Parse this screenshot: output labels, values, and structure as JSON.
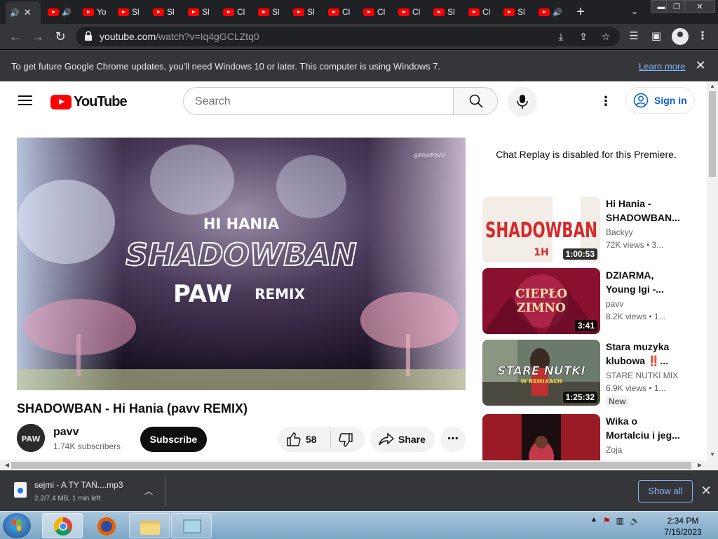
{
  "tabs": [
    {
      "label": "",
      "icon": "speaker-icon",
      "active": true
    },
    {
      "label": "",
      "icon": "youtube-favicon",
      "speaker": true
    },
    {
      "label": "Yo",
      "icon": "youtube-favicon"
    },
    {
      "label": "Sl",
      "icon": "youtube-favicon"
    },
    {
      "label": "Sl",
      "icon": "youtube-favicon"
    },
    {
      "label": "Sl",
      "icon": "youtube-favicon"
    },
    {
      "label": "Cl",
      "icon": "youtube-favicon"
    },
    {
      "label": "Sl",
      "icon": "youtube-favicon"
    },
    {
      "label": "Sl",
      "icon": "youtube-favicon"
    },
    {
      "label": "Cl",
      "icon": "youtube-favicon"
    },
    {
      "label": "Cl",
      "icon": "youtube-favicon"
    },
    {
      "label": "Cl",
      "icon": "youtube-favicon"
    },
    {
      "label": "Sl",
      "icon": "youtube-favicon"
    },
    {
      "label": "Cl",
      "icon": "youtube-favicon"
    },
    {
      "label": "Sl",
      "icon": "youtube-favicon"
    },
    {
      "label": "",
      "icon": "youtube-favicon",
      "speaker": true
    }
  ],
  "toolbar": {
    "url_host": "youtube.com",
    "url_path": "/watch?v=Iq4gGCLZtq0"
  },
  "infobar": {
    "message": "To get future Google Chrome updates, you'll need Windows 10 or later. This computer is using Windows 7.",
    "link": "Learn more"
  },
  "youtube": {
    "logo_text": "YouTube",
    "search_placeholder": "Search",
    "signin_label": "Sign in",
    "video": {
      "title": "SHADOWBAN - Hi Hania (pavv REMIX)",
      "overlay_artist": "HI HANIA",
      "overlay_title": "SHADOWBAN",
      "overlay_brand": "PAW",
      "overlay_remix": "REMIX",
      "overlay_handle": "@PAWPAVV"
    },
    "channel": {
      "name": "pavv",
      "subscribers": "1.74K subscribers",
      "avatar_text": "PAW"
    },
    "subscribe_label": "Subscribe",
    "likes": "58",
    "share_label": "Share",
    "chat_replay": "Chat Replay is disabled for this Premiere.",
    "recommendations": [
      {
        "title_line1": "Hi Hania -",
        "title_line2": "SHADOWBAN...",
        "channel": "Backyy",
        "meta": "72K views • 3...",
        "duration": "1:00:53",
        "thumb_text": "SHADOWBAN",
        "thumb_sub": "1H"
      },
      {
        "title_line1": "DZIARMA,",
        "title_line2": "Young Igi -...",
        "channel": "pavv",
        "meta": "8.2K views • 1...",
        "duration": "3:41",
        "thumb_text": "CIEPŁO",
        "thumb_sub": "ZIMNO"
      },
      {
        "title_line1": "Stara muzyka",
        "title_line2": "klubowa ‼️...",
        "channel": "STARE NUTKI MIX",
        "meta": "6.9K views • 1...",
        "duration": "1:25:32",
        "thumb_text": "STARE NUTKI",
        "thumb_sub": "W REMIXACH",
        "badge": "New"
      },
      {
        "title_line1": "Wika o",
        "title_line2": "Mortalciu i jeg...",
        "channel": "Zoja",
        "meta": "",
        "duration": "",
        "thumb_text": "",
        "thumb_sub": ""
      }
    ]
  },
  "download": {
    "filename": "sejmi - A TY TAŃ....mp3",
    "status": "2.2/7.4 MB, 1 min left",
    "show_all": "Show all"
  },
  "taskbar": {
    "time": "2:34 PM",
    "date": "7/15/2023"
  }
}
